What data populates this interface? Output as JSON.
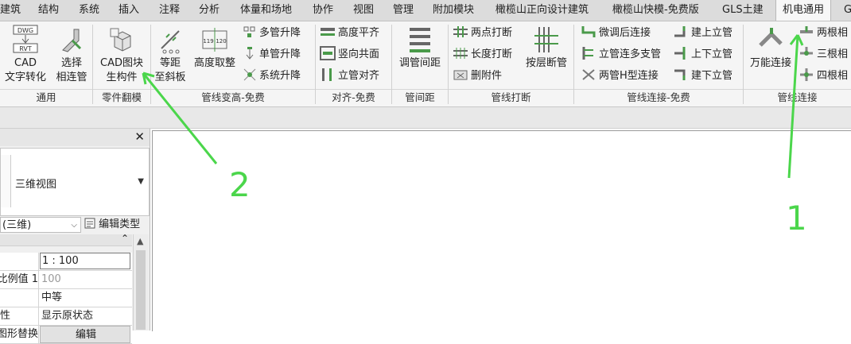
{
  "tabs": [
    {
      "label": "建筑"
    },
    {
      "label": "结构"
    },
    {
      "label": "系统"
    },
    {
      "label": "插入"
    },
    {
      "label": "注释"
    },
    {
      "label": "分析"
    },
    {
      "label": "体量和场地"
    },
    {
      "label": "协作"
    },
    {
      "label": "视图"
    },
    {
      "label": "管理"
    },
    {
      "label": "附加模块"
    },
    {
      "label": "橄榄山正向设计建筑"
    },
    {
      "label": "橄榄山快模-免费版"
    },
    {
      "label": "GLS土建"
    },
    {
      "label": "机电通用"
    },
    {
      "label": "G"
    }
  ],
  "active_tab": "机电通用",
  "ribbon": {
    "general": {
      "cad_text_icon_line1": "DWG",
      "cad_text_icon_line2": "RVT",
      "cad_text": [
        "CAD",
        "文字转化"
      ],
      "select_pipe": [
        "选择",
        "相连管"
      ],
      "label": "通用"
    },
    "flip": {
      "cad_block": [
        "CAD图块",
        "生构件"
      ],
      "label": "零件翻模"
    },
    "elevation": {
      "equal_slope": [
        "等距",
        "至斜板"
      ],
      "height_adjust": "高度取整",
      "height_icon_left": "119",
      "height_icon_right": "120",
      "multi_lift": "多管升降",
      "single_lift": "单管升降",
      "system_lift": "系统升降",
      "label": "管线变高-免费"
    },
    "align": {
      "height_align": "高度平齐",
      "vertical_coplane": "竖向共面",
      "riser_align": "立管对齐",
      "label": "对齐-免费"
    },
    "spacing": {
      "adjust_spacing": "调管间距",
      "label": "管间距"
    },
    "break": {
      "two_point": "两点打断",
      "length_break": "长度打断",
      "delete_fitting": "删附件",
      "layer_break": "按层断管",
      "label": "管线打断"
    },
    "connect_free": {
      "fine_connect": "微调后连接",
      "riser_multi": "立管连多支管",
      "h_connect": "两管H型连接",
      "build_up": "建上立管",
      "up_down": "上下立管",
      "build_down": "建下立管",
      "label": "管线连接-免费"
    },
    "connect": {
      "universal": "万能连接",
      "two_pipes": "两根相",
      "three_pipes": "三根相",
      "four_pipes": "四根相",
      "label": "管线连接"
    }
  },
  "properties": {
    "close": "✕",
    "type_name": "三维视图",
    "view_select": "(三维)",
    "edit_type": "编辑类型",
    "rows": [
      {
        "name": "",
        "value": "1 : 100"
      },
      {
        "name": "比例值 1:",
        "value": "100"
      },
      {
        "name": "",
        "value": "中等"
      },
      {
        "name": "性",
        "value": "显示原状态"
      },
      {
        "name": "图形替换",
        "value": "编辑"
      }
    ]
  },
  "annotations": {
    "one": "1",
    "two": "2"
  },
  "colors": {
    "annotation": "#4bd64b",
    "accent_green": "#4a9a4a",
    "icon_grey": "#6a6a6a"
  }
}
